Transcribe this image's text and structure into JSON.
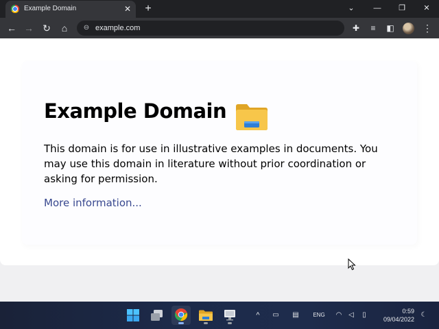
{
  "browser": {
    "tab": {
      "title": "Example Domain",
      "close_glyph": "✕"
    },
    "new_tab_glyph": "+",
    "window_controls": {
      "tab_search_glyph": "⌄",
      "minimize_glyph": "—",
      "maximize_glyph": "❐",
      "close_glyph": "✕"
    },
    "nav": {
      "back_glyph": "←",
      "forward_glyph": "→",
      "reload_glyph": "↻",
      "home_glyph": "⌂"
    },
    "omnibox": {
      "url": "example.com",
      "lock_glyph": "⊖"
    },
    "toolbar_icons": {
      "extensions_glyph": "✚",
      "media_glyph": "≡",
      "sidepanel_glyph": "◧",
      "menu_glyph": "⋮"
    }
  },
  "page": {
    "heading": "Example Domain",
    "paragraph": "This domain is for use in illustrative examples in documents. You may use this domain in literature without prior coordination or asking for permission.",
    "link_text": "More information..."
  },
  "taskbar": {
    "items": [
      {
        "icon": "windows-start-icon"
      },
      {
        "icon": "task-view-icon"
      },
      {
        "icon": "chrome-icon",
        "active": true
      },
      {
        "icon": "file-explorer-icon"
      },
      {
        "icon": "remote-desktop-icon"
      }
    ],
    "tray": {
      "chevron_glyph": "^",
      "icon_a_glyph": "▭",
      "icon_b_glyph": "▤",
      "language": "ENG",
      "wifi_glyph": "◠",
      "volume_glyph": "◁",
      "battery_glyph": "▯",
      "time": "0:59",
      "date": "09/04/2022",
      "notification_glyph": "☾"
    }
  },
  "colors": {
    "titlebar": "#202124",
    "tab": "#35363a",
    "link": "#38488f",
    "chrome_active_indicator": "#8ab4f8"
  }
}
